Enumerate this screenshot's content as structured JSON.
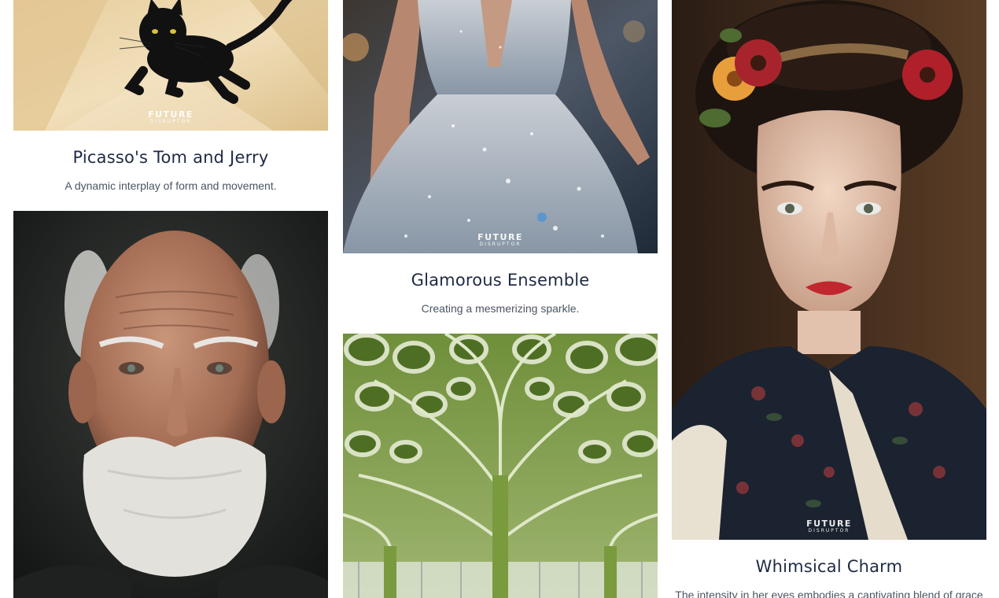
{
  "watermark": {
    "line1": "FUTURE",
    "line2": "DISRUPTOR"
  },
  "cards": [
    {
      "title": "Picasso's Tom and Jerry",
      "description": "A dynamic interplay of form and movement."
    },
    {
      "title": "Glamorous Ensemble",
      "description": "Creating a mesmerizing sparkle."
    },
    {
      "title": "Whimsical Charm",
      "description": "The intensity in her eyes embodies a captivating blend of grace"
    }
  ],
  "images": [
    {
      "subject": "black-cat-picasso-style"
    },
    {
      "subject": "old-man-portrait"
    },
    {
      "subject": "sparkling-dress"
    },
    {
      "subject": "organic-tree-architecture"
    },
    {
      "subject": "woman-with-flowers-portrait"
    }
  ]
}
